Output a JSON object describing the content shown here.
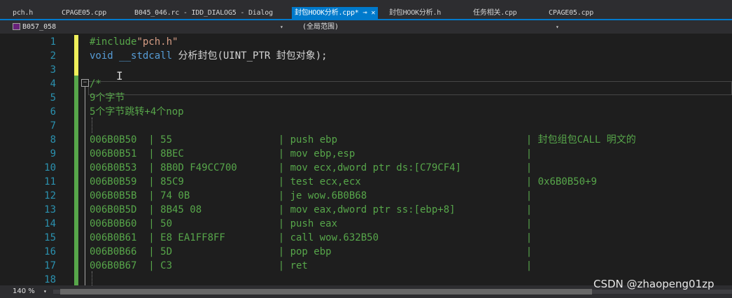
{
  "tabs": [
    {
      "label": "pch.h",
      "active": false
    },
    {
      "label": "CPAGE05.cpp",
      "active": false
    },
    {
      "label": "B045_046.rc - IDD_DIALOG5 - Dialog",
      "active": false
    },
    {
      "label": "封包HOOK分析.cpp*",
      "active": true,
      "pin_icon": "pin-icon",
      "close_icon": "close-icon"
    },
    {
      "label": "封包HOOK分析.h",
      "active": false
    },
    {
      "label": "任务相关.cpp",
      "active": false
    },
    {
      "label": "CPAGE05.cpp",
      "active": false
    }
  ],
  "navbar": {
    "project": "B057_058",
    "scope": "(全局范围)"
  },
  "editor": {
    "lines": [
      {
        "n": "1",
        "parts": [
          {
            "t": "#include",
            "c": "green"
          },
          {
            "t": "\"pch.h\"",
            "c": "string"
          }
        ]
      },
      {
        "n": "2",
        "parts": [
          {
            "t": "void",
            "c": "blue"
          },
          {
            "t": " ",
            "c": ""
          },
          {
            "t": "__stdcall",
            "c": "blue"
          },
          {
            "t": " 分析封包(UINT_PTR 封包对象);",
            "c": ""
          }
        ]
      },
      {
        "n": "3",
        "parts": []
      },
      {
        "n": "4",
        "parts": [
          {
            "t": "/*",
            "c": "green"
          }
        ]
      },
      {
        "n": "5",
        "parts": [
          {
            "t": "9个字节",
            "c": "green"
          }
        ]
      },
      {
        "n": "6",
        "parts": [
          {
            "t": "5个字节跳转+4个nop",
            "c": "green"
          }
        ]
      },
      {
        "n": "7",
        "parts": []
      },
      {
        "n": "8",
        "parts": [
          {
            "t": "006B0B50  | 55                  | push ebp                                | 封包组包CALL 明文的",
            "c": "green"
          }
        ]
      },
      {
        "n": "9",
        "parts": [
          {
            "t": "006B0B51  | 8BEC                | mov ebp,esp                             |",
            "c": "green"
          }
        ]
      },
      {
        "n": "10",
        "parts": [
          {
            "t": "006B0B53  | 8B0D F49CC700       | mov ecx,dword ptr ds:[C79CF4]           |",
            "c": "green"
          }
        ]
      },
      {
        "n": "11",
        "parts": [
          {
            "t": "006B0B59  | 85C9                | test ecx,ecx                            | 0x6B0B50+9",
            "c": "green"
          }
        ]
      },
      {
        "n": "12",
        "parts": [
          {
            "t": "006B0B5B  | 74 0B               | je wow.6B0B68                           |",
            "c": "green"
          }
        ]
      },
      {
        "n": "13",
        "parts": [
          {
            "t": "006B0B5D  | 8B45 08             | mov eax,dword ptr ss:[ebp+8]            |",
            "c": "green"
          }
        ]
      },
      {
        "n": "14",
        "parts": [
          {
            "t": "006B0B60  | 50                  | push eax                                |",
            "c": "green"
          }
        ]
      },
      {
        "n": "15",
        "parts": [
          {
            "t": "006B0B61  | E8 EA1FF8FF         | call wow.632B50                         |",
            "c": "green"
          }
        ]
      },
      {
        "n": "16",
        "parts": [
          {
            "t": "006B0B66  | 5D                  | pop ebp                                 |",
            "c": "green"
          }
        ]
      },
      {
        "n": "17",
        "parts": [
          {
            "t": "006B0B67  | C3                  | ret                                     |",
            "c": "green"
          }
        ]
      },
      {
        "n": "18",
        "parts": []
      }
    ]
  },
  "statusbar": {
    "zoom": "140 %"
  },
  "watermark": "CSDN @zhaopeng01zp",
  "colors": {
    "accent": "#007acc",
    "comment": "#57a64a",
    "keyword": "#569cd6",
    "string": "#d69d85",
    "line_number": "#2b91af"
  }
}
